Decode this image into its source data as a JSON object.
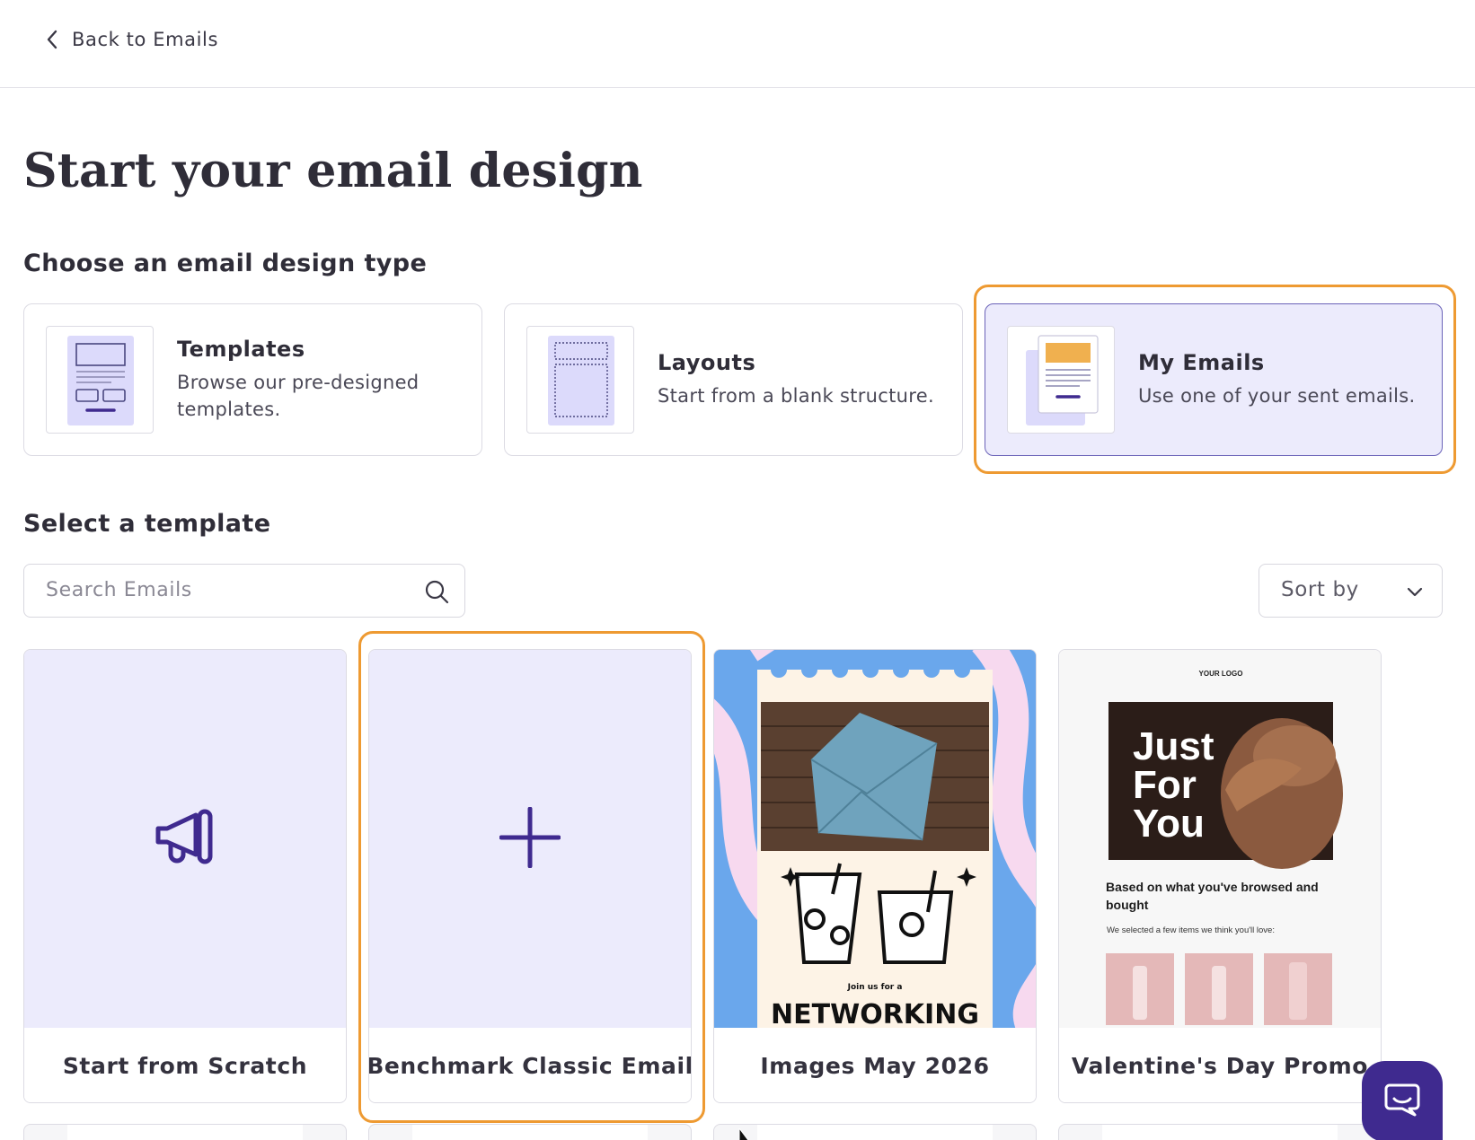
{
  "nav": {
    "back_label": "Back to Emails"
  },
  "page": {
    "title": "Start your email design"
  },
  "design_type": {
    "heading": "Choose an email design type",
    "options": [
      {
        "title": "Templates",
        "description": "Browse our pre-designed templates.",
        "selected": false,
        "icon": "template-thumbnail-icon"
      },
      {
        "title": "Layouts",
        "description": "Start from a blank structure.",
        "selected": false,
        "icon": "layout-thumbnail-icon"
      },
      {
        "title": "My Emails",
        "description": "Use one of your sent emails.",
        "selected": true,
        "icon": "my-emails-thumbnail-icon"
      }
    ]
  },
  "template_section": {
    "heading": "Select a template",
    "search": {
      "placeholder": "Search Emails",
      "value": ""
    },
    "sort": {
      "label": "Sort by"
    }
  },
  "templates": [
    {
      "name": "Start from Scratch",
      "preview": "megaphone-icon"
    },
    {
      "name": "Benchmark Classic Email",
      "preview": "plus-icon"
    },
    {
      "name": "Images May 2026",
      "preview_text": {
        "invite": "Join us for a",
        "headline": "NETWORKING"
      }
    },
    {
      "name": "Valentine's Day Promo",
      "preview_text": {
        "logo": "YOUR LOGO",
        "hero_line1": "Just",
        "hero_line2": "For",
        "hero_line3": "You",
        "heading": "Based on what you've browsed and bought",
        "subtext": "We selected a few items we think you'll love:"
      }
    }
  ],
  "colors": {
    "accent_highlight": "#ee9a32",
    "card_tint": "#ecebfc",
    "brand_purple": "#3f2a8f"
  }
}
